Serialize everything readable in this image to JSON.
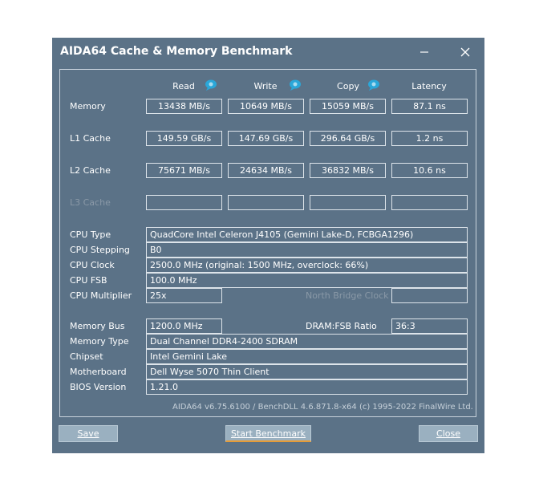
{
  "window": {
    "title": "AIDA64 Cache & Memory Benchmark"
  },
  "columns": {
    "read": "Read",
    "write": "Write",
    "copy": "Copy",
    "latency": "Latency"
  },
  "bench": {
    "memory": {
      "label": "Memory",
      "read": "13438 MB/s",
      "write": "10649 MB/s",
      "copy": "15059 MB/s",
      "latency": "87.1 ns"
    },
    "l1": {
      "label": "L1 Cache",
      "read": "149.59 GB/s",
      "write": "147.69 GB/s",
      "copy": "296.64 GB/s",
      "latency": "1.2 ns"
    },
    "l2": {
      "label": "L2 Cache",
      "read": "75671 MB/s",
      "write": "24634 MB/s",
      "copy": "36832 MB/s",
      "latency": "10.6 ns"
    },
    "l3": {
      "label": "L3 Cache",
      "read": "",
      "write": "",
      "copy": "",
      "latency": ""
    }
  },
  "info": {
    "cpu_type": {
      "label": "CPU Type",
      "value": "QuadCore Intel Celeron J4105  (Gemini Lake-D, FCBGA1296)"
    },
    "cpu_stepping": {
      "label": "CPU Stepping",
      "value": "B0"
    },
    "cpu_clock": {
      "label": "CPU Clock",
      "value": "2500.0 MHz  (original: 1500 MHz, overclock: 66%)"
    },
    "cpu_fsb": {
      "label": "CPU FSB",
      "value": "100.0 MHz"
    },
    "cpu_multiplier": {
      "label": "CPU Multiplier",
      "value": "25x"
    },
    "north_bridge_clock": {
      "label": "North Bridge Clock",
      "value": ""
    },
    "memory_bus": {
      "label": "Memory Bus",
      "value": "1200.0 MHz"
    },
    "dram_fsb_ratio": {
      "label": "DRAM:FSB Ratio",
      "value": "36:3"
    },
    "memory_type": {
      "label": "Memory Type",
      "value": "Dual Channel DDR4-2400 SDRAM"
    },
    "chipset": {
      "label": "Chipset",
      "value": "Intel Gemini Lake"
    },
    "motherboard": {
      "label": "Motherboard",
      "value": "Dell Wyse 5070 Thin Client"
    },
    "bios_version": {
      "label": "BIOS Version",
      "value": "1.21.0"
    }
  },
  "footer": {
    "text": "AIDA64 v6.75.6100 / BenchDLL 4.6.871.8-x64  (c) 1995-2022 FinalWire Ltd."
  },
  "buttons": {
    "save": "Save",
    "start": "Start Benchmark",
    "close": "Close"
  },
  "icons": {
    "column_info": "speech-bubble-icon",
    "minimize": "minimize-icon",
    "close": "close-icon"
  },
  "colors": {
    "window_bg": "#5b7287",
    "button_bg": "#9ab0c0",
    "focus_accent": "#e59c38"
  }
}
